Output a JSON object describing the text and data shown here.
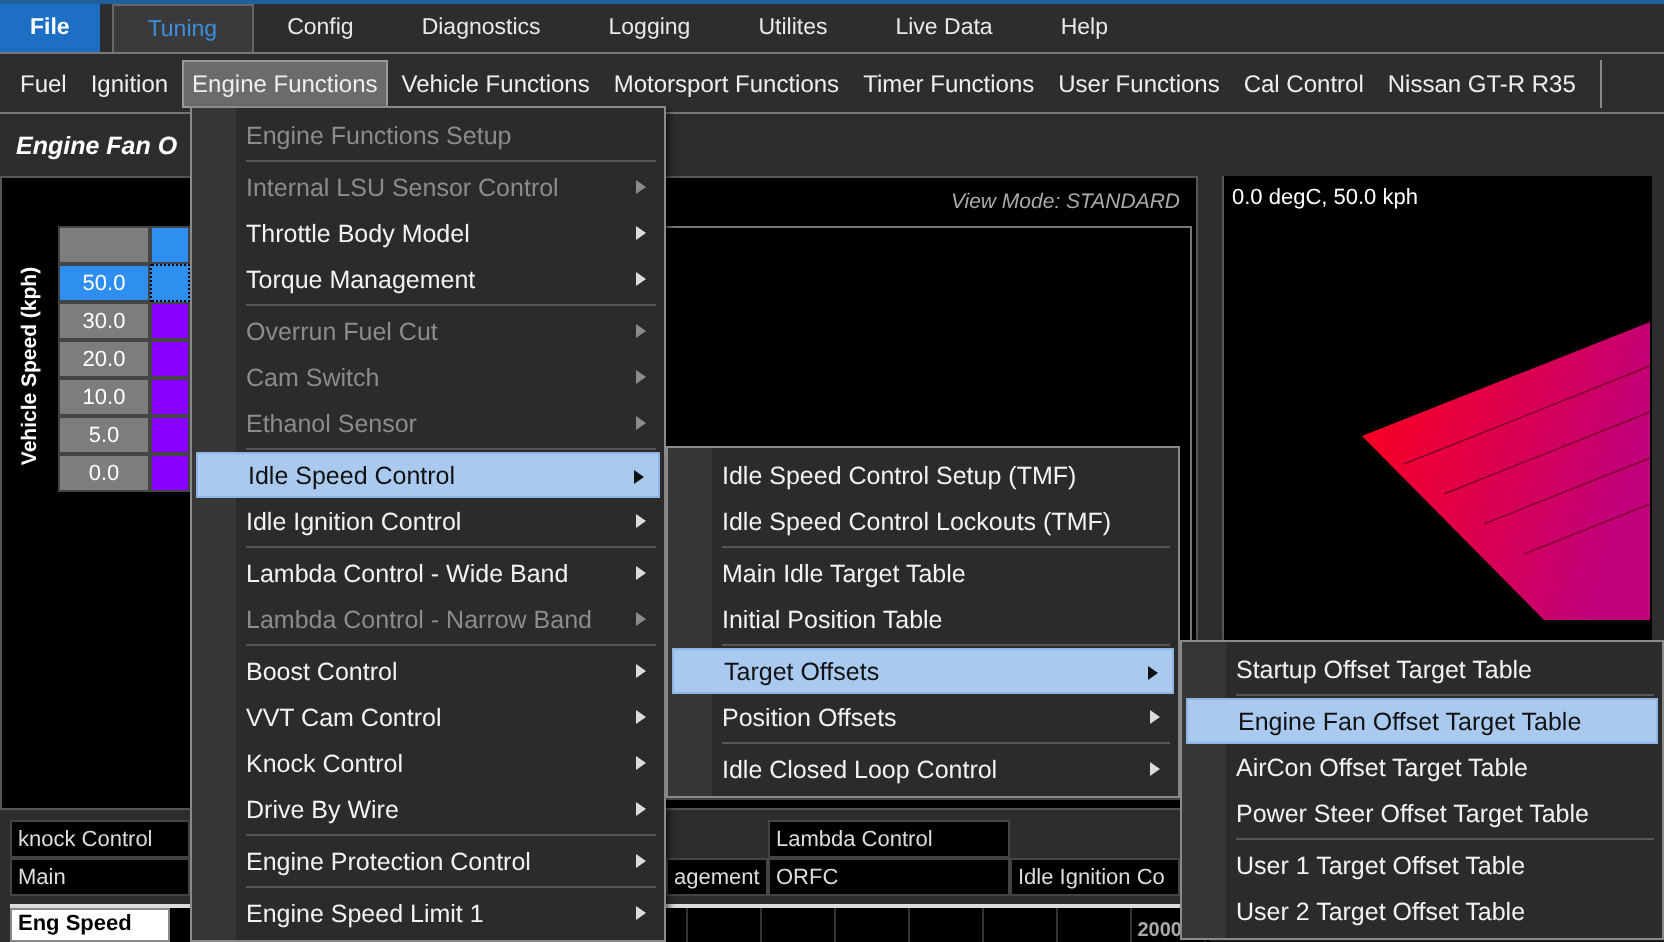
{
  "top_tabs": [
    {
      "label": "File",
      "kind": "file",
      "selected": false
    },
    {
      "label": "Tuning",
      "kind": "tab",
      "selected": true
    },
    {
      "label": "Config",
      "kind": "tab",
      "selected": false
    },
    {
      "label": "Diagnostics",
      "kind": "tab",
      "selected": false
    },
    {
      "label": "Logging",
      "kind": "tab",
      "selected": false
    },
    {
      "label": "Utilites",
      "kind": "tab",
      "selected": false
    },
    {
      "label": "Live Data",
      "kind": "tab",
      "selected": false
    },
    {
      "label": "Help",
      "kind": "tab",
      "selected": false
    }
  ],
  "ribbon": [
    {
      "label": "Fuel",
      "open": false
    },
    {
      "label": "Ignition",
      "open": false
    },
    {
      "label": "Engine Functions",
      "open": true
    },
    {
      "label": "Vehicle Functions",
      "open": false
    },
    {
      "label": "Motorsport Functions",
      "open": false
    },
    {
      "label": "Timer Functions",
      "open": false
    },
    {
      "label": "User Functions",
      "open": false
    },
    {
      "label": "Cal Control",
      "open": false
    },
    {
      "label": "Nissan GT-R R35",
      "open": false
    }
  ],
  "view_title": "Engine Fan O",
  "map_view": {
    "axis_label": "Vehicle Speed (kph)",
    "view_mode": "View Mode: STANDARD",
    "rows": [
      {
        "label": "50.0",
        "selected": true
      },
      {
        "label": "30.0",
        "selected": false
      },
      {
        "label": "20.0",
        "selected": false
      },
      {
        "label": "10.0",
        "selected": false
      },
      {
        "label": "5.0",
        "selected": false
      },
      {
        "label": "0.0",
        "selected": false
      }
    ]
  },
  "surface_view": {
    "readout": "0.0 degC, 50.0 kph"
  },
  "bottom_tabs": [
    {
      "column_1": "knock Control",
      "column_3": "Lambda Control"
    },
    {
      "column_1": "Main",
      "column_2": "agement",
      "column_3": "ORFC",
      "column_4": "Idle Ignition Co"
    }
  ],
  "trace": {
    "label": "Eng Speed",
    "tick": "2000"
  },
  "menus": [
    {
      "items": [
        {
          "label": "Engine Functions Setup",
          "enabled": false,
          "submenu": false,
          "selected": false,
          "separator_after": true
        },
        {
          "label": "Internal LSU Sensor Control",
          "enabled": false,
          "submenu": true,
          "selected": false,
          "separator_after": false
        },
        {
          "label": "Throttle Body Model",
          "enabled": true,
          "submenu": true,
          "selected": false,
          "separator_after": false
        },
        {
          "label": "Torque Management",
          "enabled": true,
          "submenu": true,
          "selected": false,
          "separator_after": true
        },
        {
          "label": "Overrun Fuel Cut",
          "enabled": false,
          "submenu": true,
          "selected": false,
          "separator_after": false
        },
        {
          "label": "Cam Switch",
          "enabled": false,
          "submenu": true,
          "selected": false,
          "separator_after": false
        },
        {
          "label": "Ethanol Sensor",
          "enabled": false,
          "submenu": true,
          "selected": false,
          "separator_after": true
        },
        {
          "label": "Idle Speed Control",
          "enabled": true,
          "submenu": true,
          "selected": true,
          "separator_after": false
        },
        {
          "label": "Idle Ignition Control",
          "enabled": true,
          "submenu": true,
          "selected": false,
          "separator_after": true
        },
        {
          "label": "Lambda Control - Wide Band",
          "enabled": true,
          "submenu": true,
          "selected": false,
          "separator_after": false
        },
        {
          "label": "Lambda Control - Narrow Band",
          "enabled": false,
          "submenu": true,
          "selected": false,
          "separator_after": true
        },
        {
          "label": "Boost Control",
          "enabled": true,
          "submenu": true,
          "selected": false,
          "separator_after": false
        },
        {
          "label": "VVT Cam Control",
          "enabled": true,
          "submenu": true,
          "selected": false,
          "separator_after": false
        },
        {
          "label": "Knock Control",
          "enabled": true,
          "submenu": true,
          "selected": false,
          "separator_after": false
        },
        {
          "label": "Drive By Wire",
          "enabled": true,
          "submenu": true,
          "selected": false,
          "separator_after": true
        },
        {
          "label": "Engine Protection Control",
          "enabled": true,
          "submenu": true,
          "selected": false,
          "separator_after": true
        },
        {
          "label": "Engine Speed Limit 1",
          "enabled": true,
          "submenu": true,
          "selected": false,
          "separator_after": false
        }
      ]
    },
    {
      "items": [
        {
          "label": "Idle Speed Control Setup (TMF)",
          "enabled": true,
          "submenu": false,
          "selected": false,
          "separator_after": false
        },
        {
          "label": "Idle Speed Control Lockouts (TMF)",
          "enabled": true,
          "submenu": false,
          "selected": false,
          "separator_after": true
        },
        {
          "label": "Main Idle Target Table",
          "enabled": true,
          "submenu": false,
          "selected": false,
          "separator_after": false
        },
        {
          "label": "Initial Position Table",
          "enabled": true,
          "submenu": false,
          "selected": false,
          "separator_after": true
        },
        {
          "label": "Target Offsets",
          "enabled": true,
          "submenu": true,
          "selected": true,
          "separator_after": false
        },
        {
          "label": "Position Offsets",
          "enabled": true,
          "submenu": true,
          "selected": false,
          "separator_after": true
        },
        {
          "label": "Idle Closed Loop Control",
          "enabled": true,
          "submenu": true,
          "selected": false,
          "separator_after": false
        }
      ]
    },
    {
      "items": [
        {
          "label": "Startup Offset Target Table",
          "enabled": true,
          "submenu": false,
          "selected": false,
          "separator_after": true
        },
        {
          "label": "Engine Fan Offset Target Table",
          "enabled": true,
          "submenu": false,
          "selected": true,
          "separator_after": false
        },
        {
          "label": "AirCon Offset Target Table",
          "enabled": true,
          "submenu": false,
          "selected": false,
          "separator_after": false
        },
        {
          "label": "Power Steer Offset Target Table",
          "enabled": true,
          "submenu": false,
          "selected": false,
          "separator_after": true
        },
        {
          "label": "User 1 Target Offset Table",
          "enabled": true,
          "submenu": false,
          "selected": false,
          "separator_after": false
        },
        {
          "label": "User 2 Target  Offset Table",
          "enabled": true,
          "submenu": false,
          "selected": false,
          "separator_after": false
        }
      ]
    }
  ]
}
